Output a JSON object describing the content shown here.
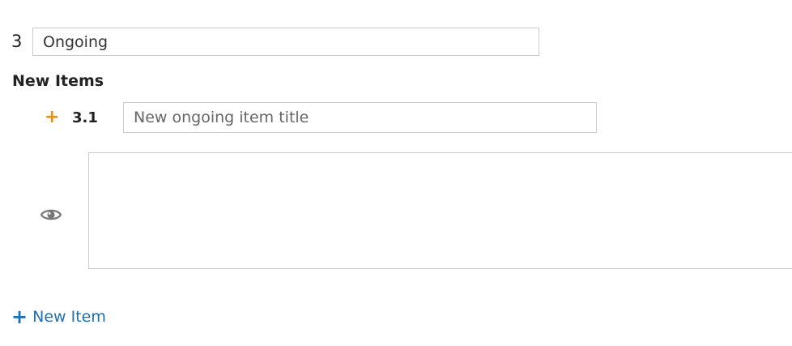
{
  "section": {
    "number": "3",
    "title_value": "Ongoing"
  },
  "new_items": {
    "heading": "New Items",
    "items": [
      {
        "marker": "+",
        "number": "3.1",
        "title_placeholder": "New ongoing item title",
        "title_value": "",
        "body_value": "",
        "visibility_icon": "eye-icon"
      }
    ],
    "add_button": {
      "icon": "+",
      "label": "New Item"
    }
  },
  "colors": {
    "accent_orange": "#f28c00",
    "link_blue": "#1f6fb2",
    "border_gray": "#cccccc",
    "icon_gray": "#777777"
  }
}
